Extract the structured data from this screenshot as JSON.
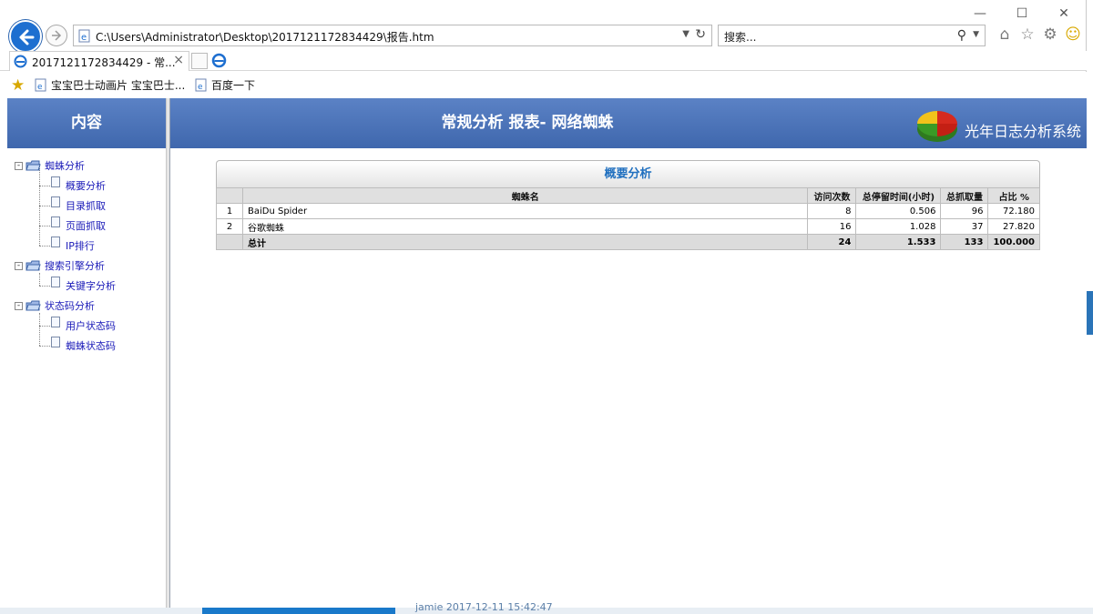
{
  "browser": {
    "address_url": "C:\\Users\\Administrator\\Desktop\\2017121172834429\\报告.htm",
    "search_placeholder": "搜索...",
    "tab_title": "2017121172834429 - 常...",
    "favorites": [
      "宝宝巴士动画片 宝宝巴士...",
      "百度一下"
    ]
  },
  "sidebar": {
    "title": "内容",
    "groups": [
      {
        "label": "蜘蛛分析",
        "items": [
          "概要分析",
          "目录抓取",
          "页面抓取",
          "IP排行"
        ]
      },
      {
        "label": "搜索引擎分析",
        "items": [
          "关键字分析"
        ]
      },
      {
        "label": "状态码分析",
        "items": [
          "用户状态码",
          "蜘蛛状态码"
        ]
      }
    ]
  },
  "header": {
    "title": "常规分析 报表- 网络蜘蛛",
    "brand": "光年日志分析系统"
  },
  "summary": {
    "title": "概要分析",
    "columns": [
      "",
      "蜘蛛名",
      "访问次数",
      "总停留时间(小时)",
      "总抓取量",
      "占比 %"
    ],
    "rows": [
      {
        "idx": "1",
        "name": "BaiDu Spider",
        "visits": "8",
        "hours": "0.506",
        "pages": "96",
        "pct": "72.180"
      },
      {
        "idx": "2",
        "name": "谷歌蜘蛛",
        "visits": "16",
        "hours": "1.028",
        "pages": "37",
        "pct": "27.820"
      }
    ],
    "total": {
      "label": "总计",
      "visits": "24",
      "hours": "1.533",
      "pages": "133",
      "pct": "100.000"
    }
  },
  "background_text": "jamie  2017-12-11 15:42:47",
  "colors": {
    "header_blue": "#4a72b8",
    "title_blue": "#1f6fbf",
    "link_blue": "#1a1ab8"
  }
}
